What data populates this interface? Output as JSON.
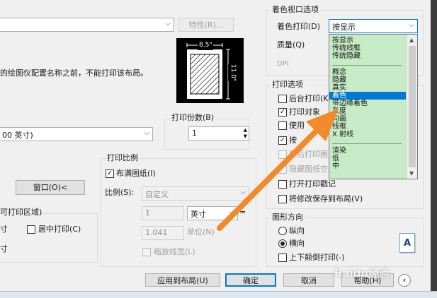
{
  "top": {
    "properties_button": "特性(R)...",
    "warning_text": "的绘图仪配置名称之前，不能打印该布局。"
  },
  "preview": {
    "width_label": "8.5\"",
    "height_label": "11.0\""
  },
  "copies": {
    "label": "打印份数(B)",
    "value": "1"
  },
  "paper": {
    "value": "00 英寸)"
  },
  "window_button": "窗口(O)<",
  "area": {
    "label": "可打印区域)",
    "unit_partial_1": "寸",
    "unit_partial_2": "寸",
    "center_print": "居中打印(C)"
  },
  "scale": {
    "group_label": "打印比例",
    "fit_paper": "布满图纸(I)",
    "scale_label": "比例(S):",
    "scale_value": "自定义",
    "value1": "1",
    "unit": "英寸",
    "equals": "=",
    "value2": "1.041",
    "unit_label": "单位(N)",
    "scale_lineweights": "缩放线宽(L)"
  },
  "shaded": {
    "group_label": "着色视口选项",
    "shade_label": "着色打印(D)",
    "shade_value": "按显示",
    "quality_label": "质量(Q)",
    "dpi_label": "DPI",
    "dropdown": {
      "groups": [
        [
          "按显示",
          "传统线框",
          "传统隐藏"
        ],
        [
          "概念",
          "隐藏",
          "真实",
          "着色",
          "带边缘着色",
          "灰度",
          "勾画",
          "线框",
          "X 射线"
        ],
        [
          "渲染",
          "低",
          "中"
        ]
      ],
      "selected": "着色"
    }
  },
  "options": {
    "group_label": "打印选项",
    "background": "后台打印(K)",
    "object_lw": "打印对象",
    "use_style": "使用",
    "plot_style": "按",
    "last_plot": "最后打印图",
    "hide_paper": "隐藏图纸空",
    "stamp": "打开打印戳记",
    "save_changes": "将修改保存到布局(V)"
  },
  "orientation": {
    "group_label": "图形方向",
    "portrait": "纵向",
    "landscape": "横向",
    "upside_down": "上下颠倒打印(-)",
    "page_glyph": "A"
  },
  "buttons": {
    "apply": "应用到布局(U)",
    "ok": "确定",
    "cancel": "取消",
    "help": "帮助(H)"
  },
  "watermark": "Baidu经验",
  "colors": {
    "accent": "#0078d7",
    "arrow": "#f28a2a",
    "dropdown_bg": "#c7ebc7"
  }
}
